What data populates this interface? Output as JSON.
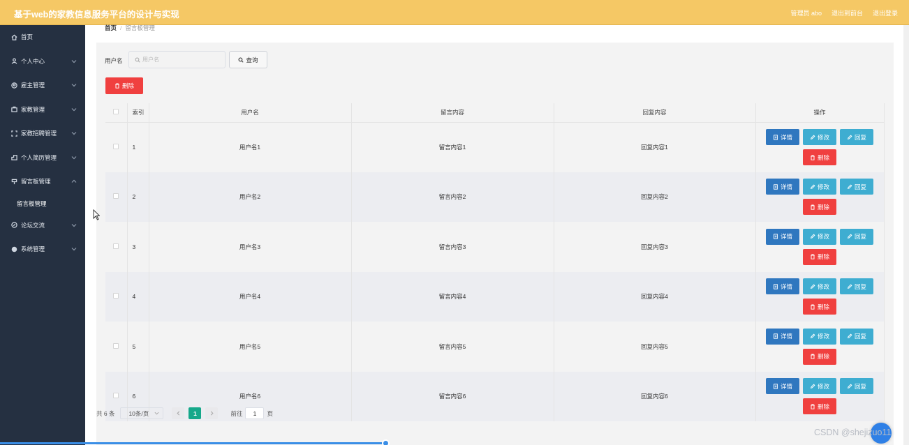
{
  "header": {
    "title": "基于web的家教信息服务平台的设计与实现",
    "admin": "管理员 abo",
    "to_front": "退出到前台",
    "logout": "退出登录"
  },
  "sidebar": {
    "items": [
      {
        "label": "首页",
        "icon": "home-icon",
        "chevron": false
      },
      {
        "label": "个人中心",
        "icon": "user-icon",
        "chevron": true
      },
      {
        "label": "雇主管理",
        "icon": "circle-user-icon",
        "chevron": true
      },
      {
        "label": "家教管理",
        "icon": "briefcase-icon",
        "chevron": true
      },
      {
        "label": "家教招聘管理",
        "icon": "frame-icon",
        "chevron": true
      },
      {
        "label": "个人简历管理",
        "icon": "resume-icon",
        "chevron": true
      },
      {
        "label": "留言板管理",
        "icon": "message-icon",
        "chevron": true,
        "open": true
      },
      {
        "label": "论坛交流",
        "icon": "forum-icon",
        "chevron": true
      },
      {
        "label": "系统管理",
        "icon": "settings-icon",
        "chevron": true
      }
    ],
    "sub_item": "留言板管理"
  },
  "breadcrumb": {
    "home": "首页",
    "sep": "/",
    "current": "留言板管理"
  },
  "search": {
    "label": "用户名",
    "placeholder": "用户名",
    "button": "查询"
  },
  "delete_button": "删除",
  "table": {
    "headers": [
      "索引",
      "用户名",
      "留言内容",
      "回复内容",
      "操作"
    ],
    "rows": [
      {
        "index": "1",
        "user": "用户名1",
        "message": "留言内容1",
        "reply": "回复内容1"
      },
      {
        "index": "2",
        "user": "用户名2",
        "message": "留言内容2",
        "reply": "回复内容2"
      },
      {
        "index": "3",
        "user": "用户名3",
        "message": "留言内容3",
        "reply": "回复内容3"
      },
      {
        "index": "4",
        "user": "用户名4",
        "message": "留言内容4",
        "reply": "回复内容4"
      },
      {
        "index": "5",
        "user": "用户名5",
        "message": "留言内容5",
        "reply": "回复内容5"
      },
      {
        "index": "6",
        "user": "用户名6",
        "message": "留言内容6",
        "reply": "回复内容6"
      }
    ],
    "ops": {
      "detail": "详情",
      "edit": "修改",
      "reply": "回复",
      "delete": "删除"
    }
  },
  "pager": {
    "total": "共 6 条",
    "page_size": "10条/页",
    "current_page": "1",
    "goto": "前往",
    "jump_value": "1",
    "page_unit": "页"
  },
  "watermark": "CSDN @shejizuo11",
  "colors": {
    "header": "#f5c865",
    "sidebar": "#253041",
    "detail": "#2f77bf",
    "edit": "#3eadd1",
    "delete": "#f0403f",
    "active_page": "#15a88a"
  }
}
